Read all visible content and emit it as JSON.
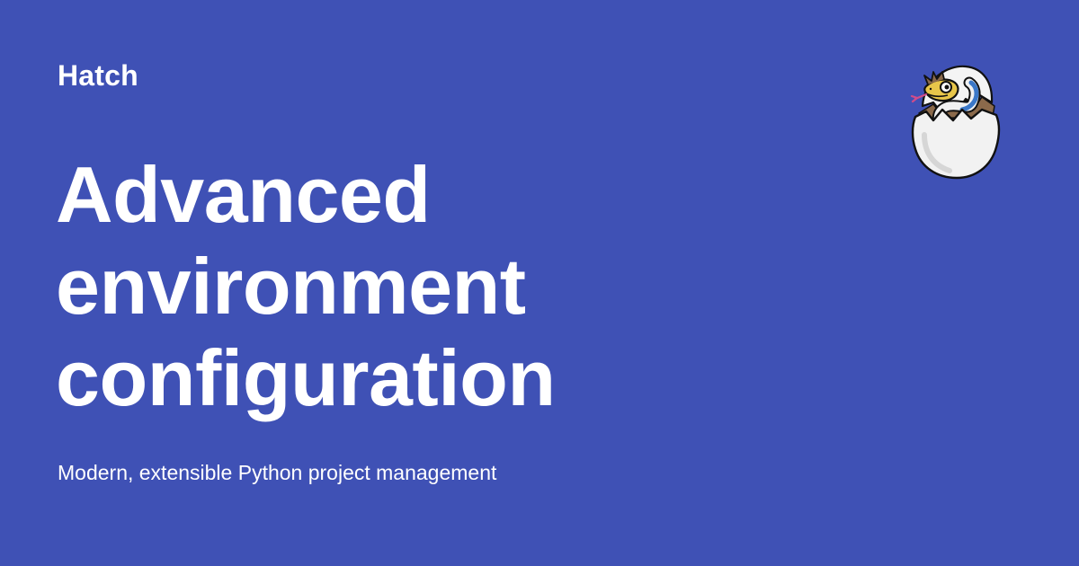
{
  "card": {
    "site_name": "Hatch",
    "title_lines": [
      "Advanced",
      "environment",
      "configuration"
    ],
    "description": "Modern, extensible Python project management"
  },
  "logo": {
    "icon": "hatching-snake-egg-icon"
  },
  "colors": {
    "background": "#3f51b5",
    "text": "#ffffff",
    "shell": "#f2f2f2",
    "snake": "#e8c64a",
    "snake_stripe": "#3b78c8",
    "shell_crack": "#8b6a4b"
  }
}
